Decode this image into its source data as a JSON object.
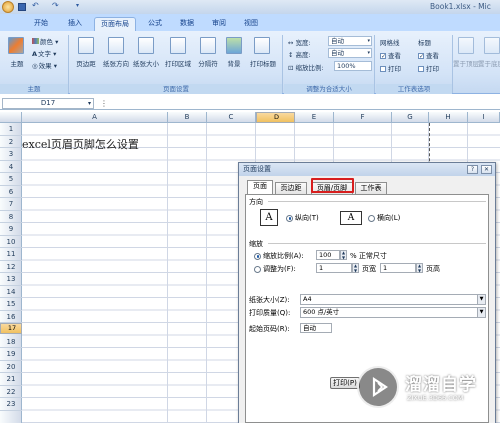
{
  "window": {
    "title": "Book1.xlsx - Mic"
  },
  "ribbon_tabs": [
    "开始",
    "插入",
    "页面布局",
    "公式",
    "数据",
    "审阅",
    "视图"
  ],
  "ribbon": {
    "theme": {
      "big_label": "主题",
      "colors": "颜色",
      "fonts": "文字",
      "effects": "效果",
      "group_label": "主题"
    },
    "page_setup": {
      "buttons": [
        "页边距",
        "纸张方向",
        "纸张大小",
        "打印区域",
        "分隔符",
        "背景",
        "打印标题"
      ],
      "group_label": "页面设置"
    },
    "scale_to_fit": {
      "width_label": "宽度:",
      "width_value": "自动",
      "height_label": "高度:",
      "height_value": "自动",
      "scale_label": "缩放比例:",
      "scale_value": "100%",
      "group_label": "调整为合适大小"
    },
    "sheet_options": {
      "gridlines": "网格线",
      "headings": "标题",
      "view": "查看",
      "print": "打印",
      "group_label": "工作表选项"
    },
    "arrange": {
      "bring_forward": "置于顶层",
      "send_backward": "置于底层"
    }
  },
  "formula_bar": {
    "name_box": "D17"
  },
  "columns": [
    "A",
    "B",
    "C",
    "D",
    "E",
    "F",
    "G",
    "H",
    "I"
  ],
  "selected_column": "D",
  "rows": [
    "1",
    "2",
    "3",
    "4",
    "5",
    "6",
    "7",
    "8",
    "9",
    "10",
    "11",
    "12",
    "13",
    "14",
    "15",
    "16",
    "17",
    "18",
    "19",
    "20",
    "21",
    "22",
    "23"
  ],
  "selected_row": "17",
  "cell_a1": "excel页眉页脚怎么设置",
  "dialog": {
    "title": "页面设置",
    "help": "?",
    "close": "✕",
    "tabs": [
      "页面",
      "页边距",
      "页眉/页脚",
      "工作表"
    ],
    "active_tab": "页面",
    "highlighted_tab": "页眉/页脚",
    "orientation": {
      "label": "方向",
      "portrait": "纵向(T)",
      "landscape": "横向(L)",
      "portrait_glyph": "A",
      "landscape_glyph": "A"
    },
    "scaling": {
      "label": "缩放",
      "adjust_option": "缩放比例(A):",
      "adjust_value": "100",
      "adjust_suffix": "% 正常尺寸",
      "fit_option": "调整为(F):",
      "fit_wide_value": "1",
      "fit_wide_label": "页宽",
      "fit_tall_value": "1",
      "fit_tall_label": "页高"
    },
    "paper_size": {
      "label": "纸张大小(Z):",
      "value": "A4"
    },
    "print_quality": {
      "label": "打印质量(Q):",
      "value": "600 点/英寸"
    },
    "first_page": {
      "label": "起始页码(R):",
      "value": "自动"
    },
    "print_button": "打印(P)"
  },
  "watermark": {
    "title": "溜溜自学",
    "subtitle": "ZIXUE.3D66.COM"
  }
}
